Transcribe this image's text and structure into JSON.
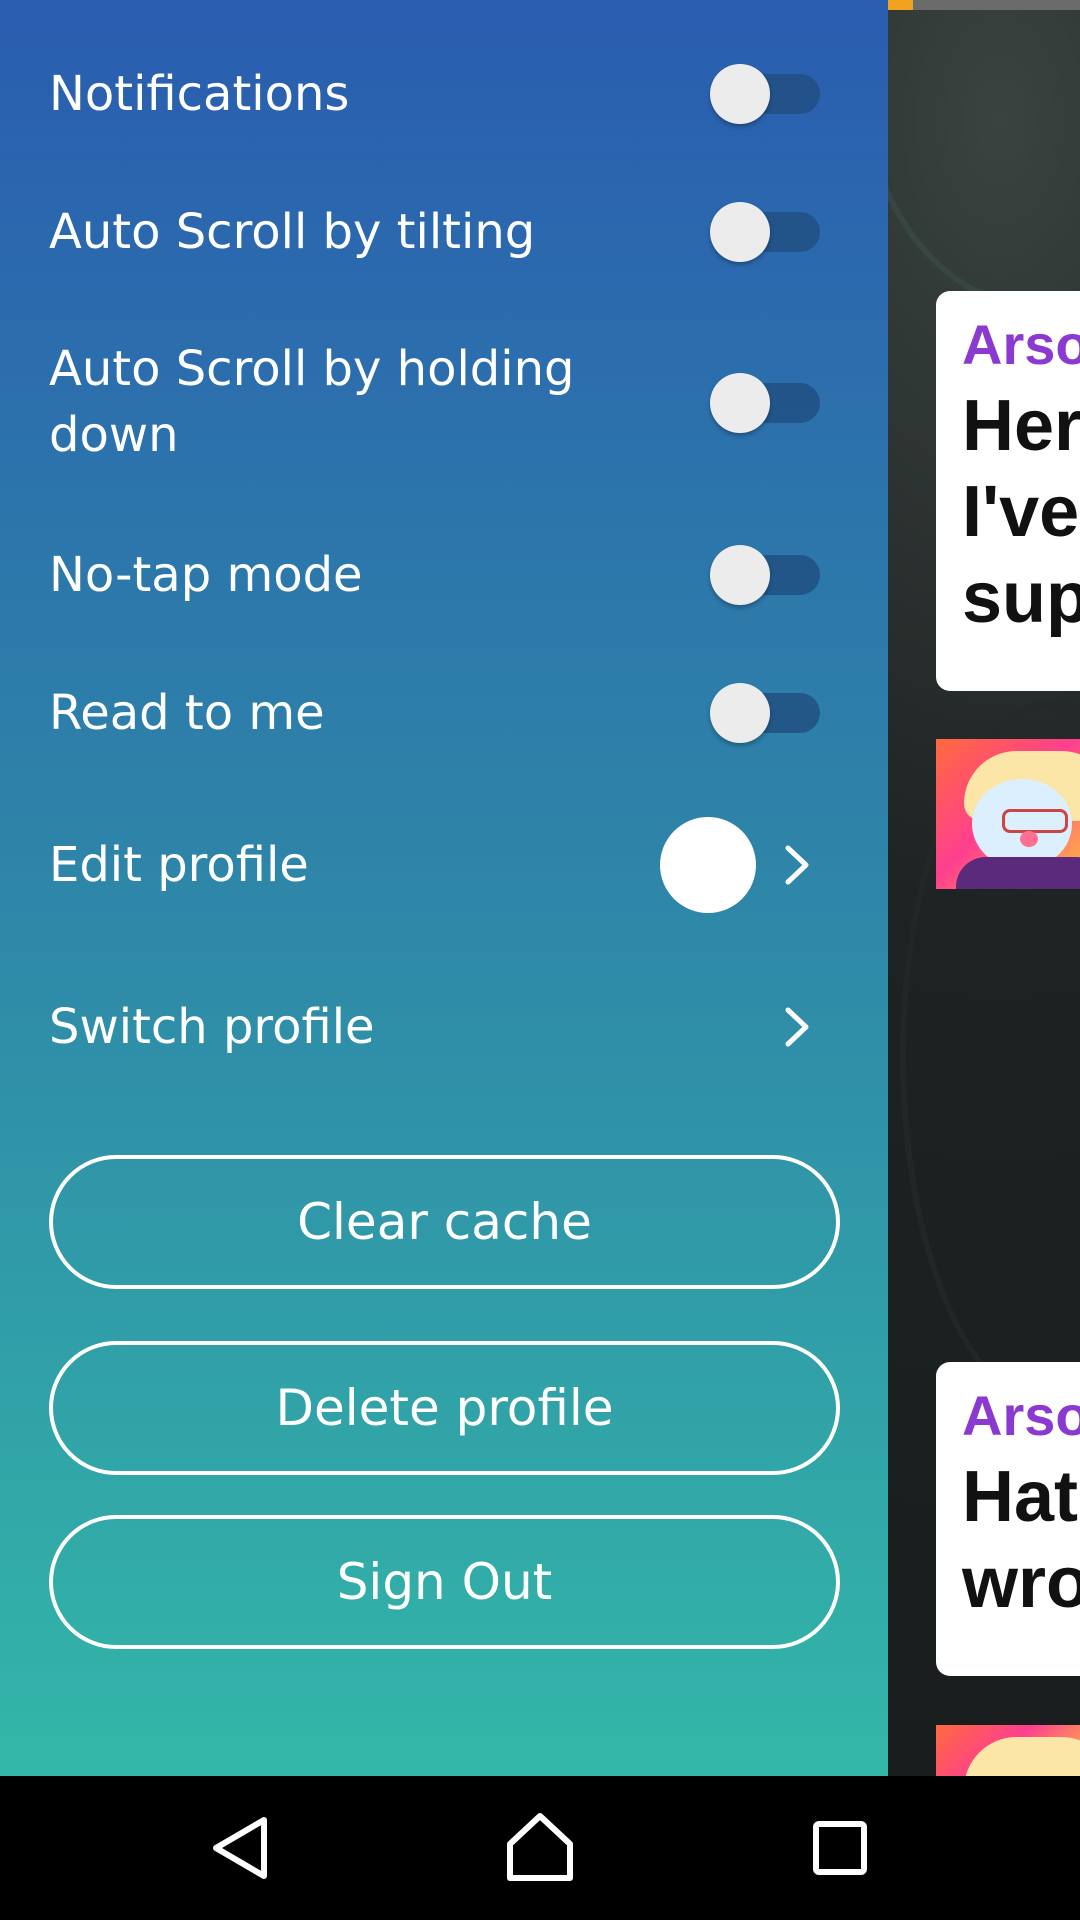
{
  "drawer": {
    "settings": [
      {
        "label": "Notifications",
        "enabled": false
      },
      {
        "label": "Auto Scroll by tilting",
        "enabled": false
      },
      {
        "label": "Auto Scroll by holding\ndown",
        "enabled": false
      },
      {
        "label": "No-tap mode",
        "enabled": false
      },
      {
        "label": "Read to me",
        "enabled": false
      }
    ],
    "edit_profile_label": "Edit profile",
    "switch_profile_label": "Switch profile",
    "buttons": {
      "clear_cache": "Clear cache",
      "delete_profile": "Delete profile",
      "sign_out": "Sign Out"
    }
  },
  "story": {
    "progress_fraction": 0.13,
    "bubbles": [
      {
        "name": "Arso",
        "text": "Her\nI've\nsup"
      },
      {
        "name": "Arso",
        "text": "Hat\nwro"
      }
    ]
  },
  "nav": {
    "icons": [
      "back-icon",
      "home-icon",
      "recents-icon"
    ]
  },
  "colors": {
    "drawer_top": "#2a5db0",
    "drawer_bottom": "#33b7a8",
    "progress": "#f2a21f",
    "bubble_name": "#8a3ad0"
  }
}
